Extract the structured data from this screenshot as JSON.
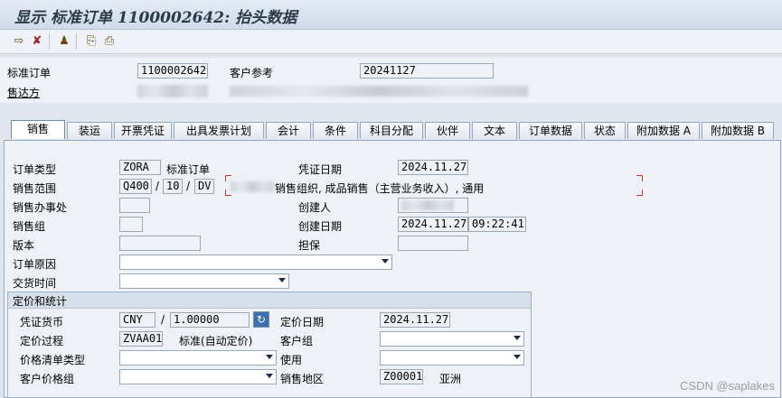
{
  "title": "显示 标准订单 1100002642: 抬头数据",
  "toolbar": {
    "icons": [
      "document-flow-icon",
      "status-overview-icon",
      "display-doc-icon",
      "output-icon",
      "print-preview-icon"
    ],
    "glyphs": [
      "⇨",
      "✘",
      "♟",
      "⎘",
      "⎙"
    ]
  },
  "header": {
    "order_label": "标准订单",
    "order_value": "1100002642",
    "custref_label": "客户参考",
    "custref_value": "20241127",
    "soldto_label": "售达方"
  },
  "tabs": [
    "销售",
    "装运",
    "开票凭证",
    "出具发票计划",
    "会计",
    "条件",
    "科目分配",
    "伙伴",
    "文本",
    "订单数据",
    "状态",
    "附加数据 A",
    "附加数据 B"
  ],
  "active_tab": "销售",
  "sales": {
    "order_type_label": "订单类型",
    "order_type_value": "ZORA",
    "order_type_text": "标准订单",
    "doc_date_label": "凭证日期",
    "doc_date_value": "2024.11.27",
    "sales_area_label": "销售范围",
    "sales_org": "Q400",
    "dist_channel": "10",
    "division": "DV",
    "sales_area_text": "销售组织, 成品销售（主营业务收入）, 通用",
    "sales_office_label": "销售办事处",
    "created_by_label": "创建人",
    "sales_group_label": "销售组",
    "created_on_label": "创建日期",
    "created_on_date": "2024.11.27",
    "created_on_time": "09:22:41",
    "version_label": "版本",
    "guarantee_label": "担保",
    "order_reason_label": "订单原因",
    "delivery_time_label": "交货时间"
  },
  "pricing": {
    "group_title": "定价和统计",
    "currency_label": "凭证货币",
    "currency_value": "CNY",
    "rate_value": "1.00000",
    "pricing_date_label": "定价日期",
    "pricing_date_value": "2024.11.27",
    "procedure_label": "定价过程",
    "procedure_value": "ZVAA01",
    "procedure_text": "标准(自动定价)",
    "customer_group_label": "客户组",
    "price_list_label": "价格清单类型",
    "usage_label": "使用",
    "cust_price_group_label": "客户价格组",
    "sales_district_label": "销售地区",
    "sales_district_value": "Z00001",
    "sales_district_text": "亚洲"
  },
  "watermark": "CSDN @saplakes"
}
